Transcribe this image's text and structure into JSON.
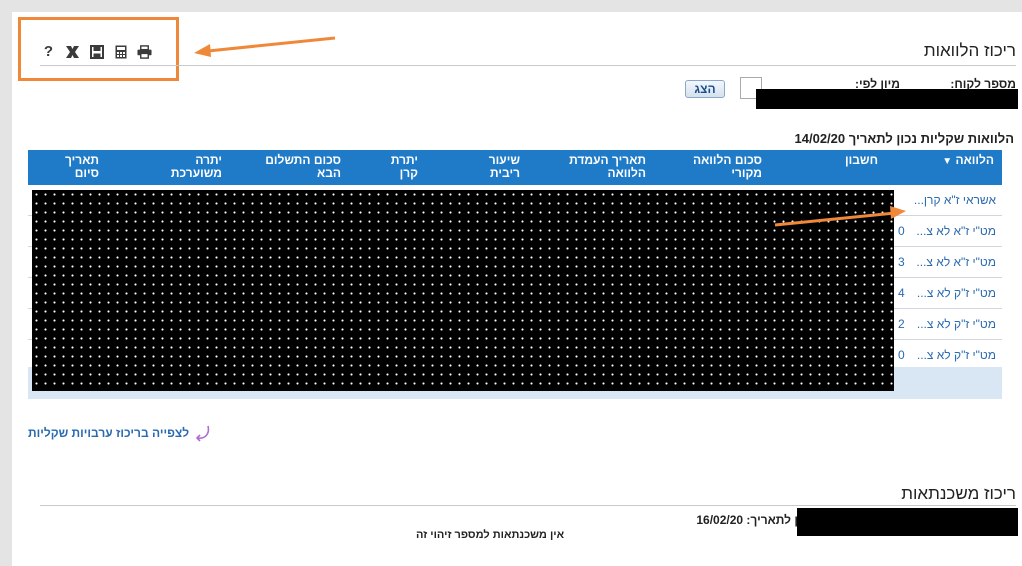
{
  "toolbar": {
    "icons": [
      "help-icon",
      "excel-icon",
      "save-icon",
      "calculator-icon",
      "print-icon"
    ],
    "help_glyph": "?"
  },
  "loans": {
    "title": "ריכוז הלוואות",
    "customer_number_label": "מספר לקוח:",
    "sort_by_label": "מיון לפי:",
    "show_button": "הצג",
    "caption": "הלוואות שקליות נכון לתאריך 14/02/20",
    "columns": [
      "הלוואה",
      "חשבון",
      "סכום הלוואה מקורי",
      "תאריך העמדת הלוואה",
      "שיעור ריבית",
      "יתרת קרן",
      "סכום התשלום הבא",
      "יתרה משוערכת",
      "תאריך סיום"
    ],
    "rows": [
      {
        "name": "אשראי ז\"א קרן...",
        "tail": ""
      },
      {
        "name": "מט\"י ז\"א לא צ...",
        "tail": "0"
      },
      {
        "name": "מט\"י ז\"א לא צ...",
        "tail": "3"
      },
      {
        "name": "מט\"י ז\"ק לא צ...",
        "tail": "4"
      },
      {
        "name": "מט\"י ז\"ק לא צ...",
        "tail": "2"
      },
      {
        "name": "מט\"י ז\"ק לא צ...",
        "tail": "0"
      }
    ],
    "guarantees_link": "לצפייה בריכוז ערבויות שקליות"
  },
  "mortgages": {
    "title": "ריכוז משכנתאות",
    "date_label": "ן לתאריך: 16/02/20",
    "empty_note": "אין משכנתאות למספר זיהוי זה"
  },
  "colors": {
    "accent": "#1f7bc7",
    "highlight": "#f0883a",
    "link": "#2a6ab0"
  }
}
